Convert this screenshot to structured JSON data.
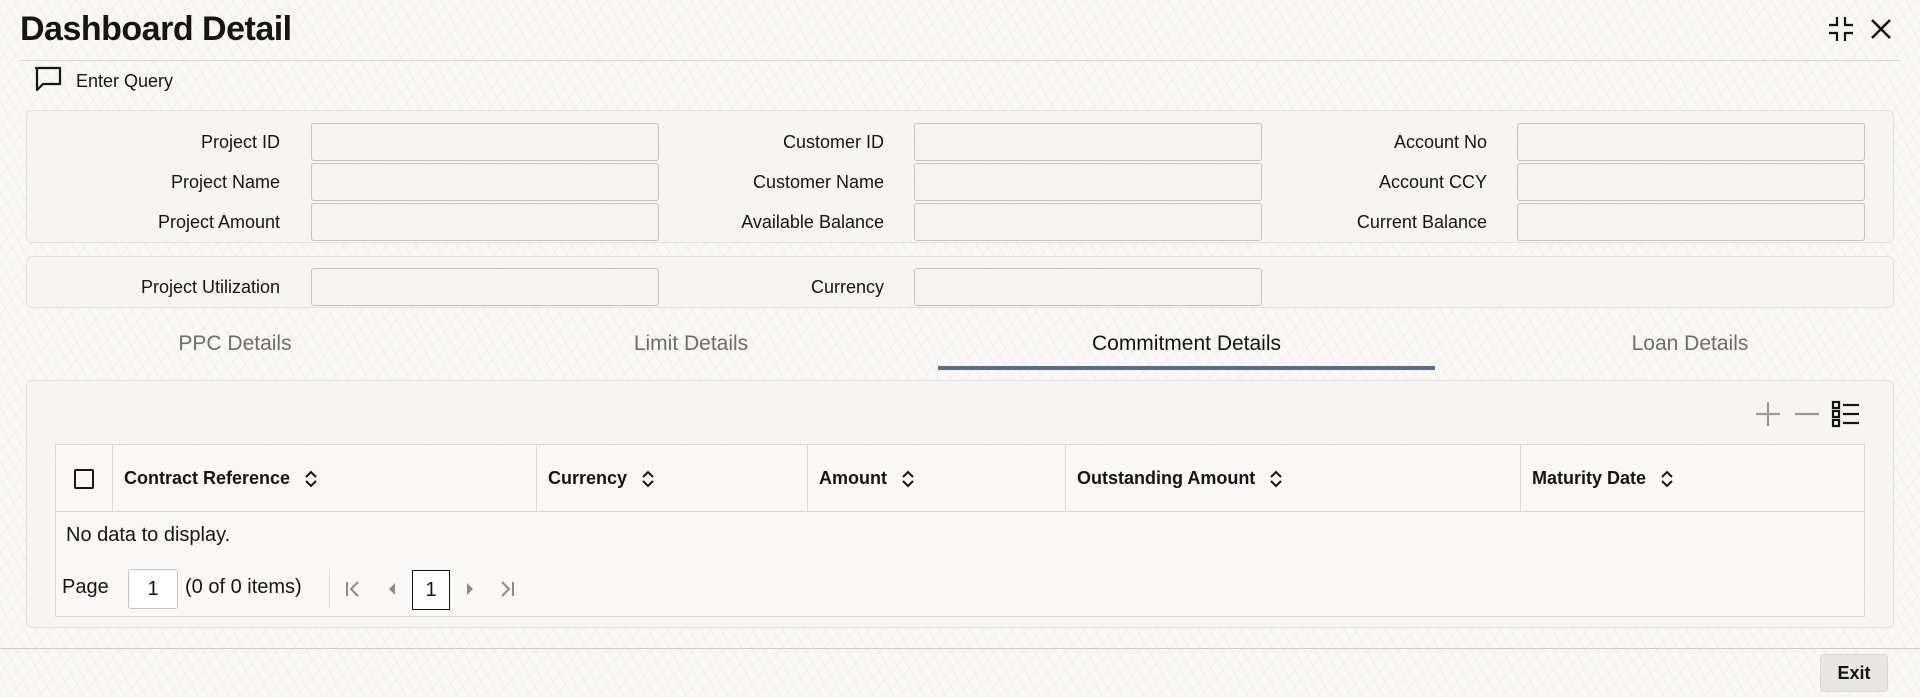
{
  "window": {
    "title": "Dashboard Detail",
    "icons": [
      "collapse-icon",
      "close-icon"
    ]
  },
  "toolbar": {
    "enter_query_label": "Enter Query"
  },
  "fields": {
    "project_id": {
      "label": "Project ID",
      "value": ""
    },
    "project_name": {
      "label": "Project Name",
      "value": ""
    },
    "project_amount": {
      "label": "Project Amount",
      "value": ""
    },
    "customer_id": {
      "label": "Customer ID",
      "value": ""
    },
    "customer_name": {
      "label": "Customer Name",
      "value": ""
    },
    "available_balance": {
      "label": "Available Balance",
      "value": ""
    },
    "account_no": {
      "label": "Account No",
      "value": ""
    },
    "account_ccy": {
      "label": "Account CCY",
      "value": ""
    },
    "current_balance": {
      "label": "Current Balance",
      "value": ""
    },
    "project_utilization": {
      "label": "Project Utilization",
      "value": ""
    },
    "currency": {
      "label": "Currency",
      "value": ""
    }
  },
  "tabs": [
    {
      "label": "PPC Details",
      "active": false
    },
    {
      "label": "Limit Details",
      "active": false
    },
    {
      "label": "Commitment Details",
      "active": true
    },
    {
      "label": "Loan Details",
      "active": false
    }
  ],
  "grid": {
    "columns": [
      "Contract Reference",
      "Currency",
      "Amount",
      "Outstanding Amount",
      "Maturity Date"
    ],
    "empty_message": "No data to display.",
    "rows": []
  },
  "pager": {
    "page_label": "Page",
    "page_value": "1",
    "items_text": "(0 of 0 items)",
    "current_page": "1"
  },
  "footer": {
    "exit_label": "Exit"
  },
  "colors": {
    "active_tab_underline": "#5b6b8c",
    "text": "#161513",
    "muted_text": "#6f6d6a"
  }
}
